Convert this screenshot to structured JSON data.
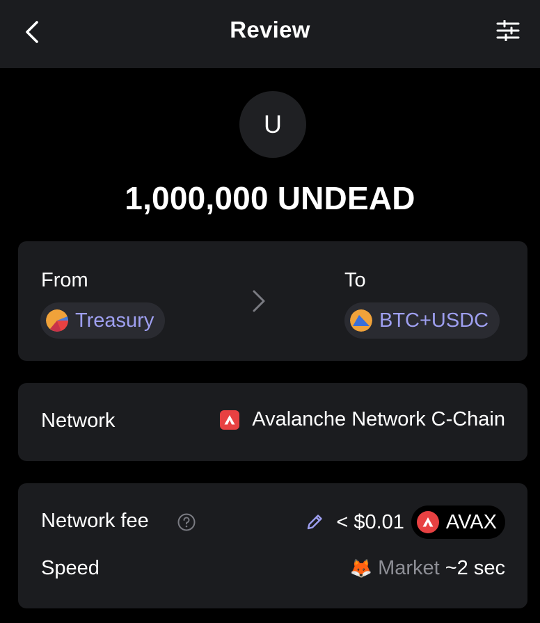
{
  "header": {
    "title": "Review"
  },
  "token": {
    "avatar_letter": "U",
    "amount": "1,000,000 UNDEAD"
  },
  "transfer": {
    "from_label": "From",
    "from_account": "Treasury",
    "to_label": "To",
    "to_account": "BTC+USDC"
  },
  "network": {
    "label": "Network",
    "value": "Avalanche Network C-Chain"
  },
  "fee": {
    "label": "Network fee",
    "value": "< $0.01",
    "token": "AVAX",
    "speed_label": "Speed",
    "speed_mode": "Market",
    "speed_time": "~2 sec",
    "speed_emoji": "🦊"
  },
  "colors": {
    "accent": "#9e9ff0",
    "avax_red": "#e84142",
    "card_bg": "#1b1c1f",
    "pill_bg": "#2a2b31"
  },
  "icons": [
    "chevron-left-icon",
    "sliders-icon",
    "chevron-right-icon",
    "help-circle-icon",
    "pencil-icon",
    "avalanche-icon",
    "fox-icon"
  ]
}
